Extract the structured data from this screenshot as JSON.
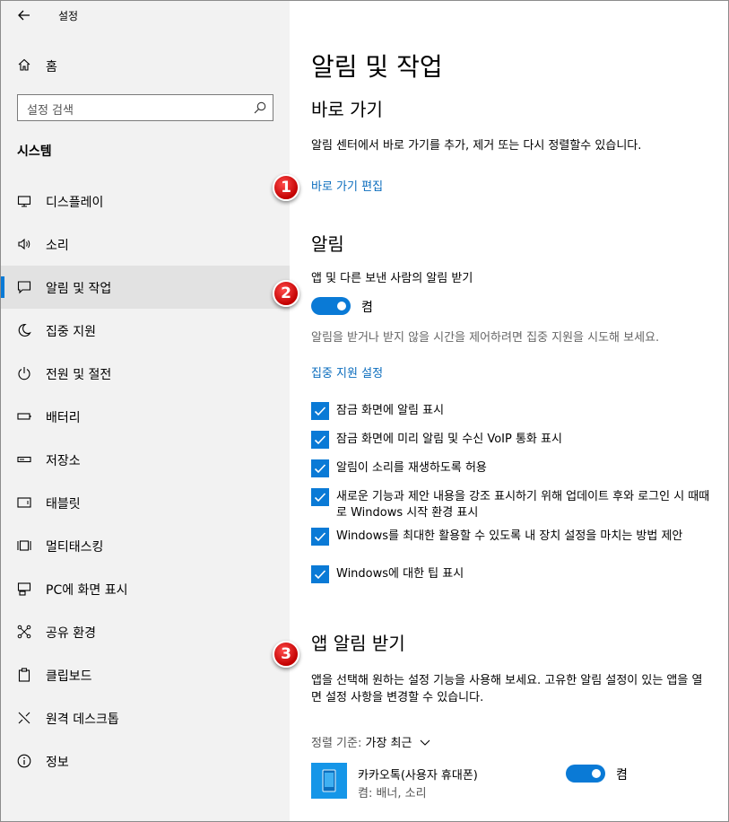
{
  "window": {
    "title": "설정"
  },
  "sidebar": {
    "home_label": "홈",
    "search_placeholder": "설정 검색",
    "section_title": "시스템",
    "items": [
      {
        "label": "디스플레이",
        "icon": "monitor-icon"
      },
      {
        "label": "소리",
        "icon": "speaker-icon"
      },
      {
        "label": "알림 및 작업",
        "icon": "notification-icon",
        "active": true
      },
      {
        "label": "집중 지원",
        "icon": "moon-icon"
      },
      {
        "label": "전원 및 절전",
        "icon": "power-icon"
      },
      {
        "label": "배터리",
        "icon": "battery-icon"
      },
      {
        "label": "저장소",
        "icon": "storage-icon"
      },
      {
        "label": "태블릿",
        "icon": "tablet-icon"
      },
      {
        "label": "멀티태스킹",
        "icon": "multitasking-icon"
      },
      {
        "label": "PC에 화면 표시",
        "icon": "project-icon"
      },
      {
        "label": "공유 환경",
        "icon": "share-icon"
      },
      {
        "label": "클립보드",
        "icon": "clipboard-icon"
      },
      {
        "label": "원격 데스크톱",
        "icon": "remote-desktop-icon"
      },
      {
        "label": "정보",
        "icon": "info-icon"
      }
    ]
  },
  "main": {
    "page_title": "알림 및 작업",
    "quick": {
      "heading": "바로 가기",
      "description": "알림 센터에서 바로 가기를 추가, 제거 또는 다시 정렬할수 있습니다.",
      "edit_link": "바로 가기 편집"
    },
    "notifications": {
      "heading": "알림",
      "toggle_title": "앱 및 다른 보낸 사람의 알림 받기",
      "toggle_state": "켬",
      "focus_desc": "알림을 받거나 받지 않을 시간을 제어하려면 집중 지원을 시도해 보세요.",
      "focus_link": "집중 지원 설정",
      "checkboxes": [
        "잠금 화면에 알림 표시",
        "잠금 화면에 미리 알림 및 수신 VoIP 통화 표시",
        "알림이 소리를 재생하도록 허용",
        "새로운 기능과 제안 내용을 강조 표시하기 위해 업데이트 후와 로그인 시 때때로 Windows 시작 환경 표시",
        "Windows를 최대한 활용할 수 있도록 내 장치 설정을 마치는 방법 제안",
        "Windows에 대한 팁 표시"
      ]
    },
    "app_notifications": {
      "heading": "앱 알림 받기",
      "description": "앱을 선택해 원하는 설정 기능을 사용해 보세요. 고유한 알림 설정이 있는 앱을 열면 설정 사항을 변경할 수 있습니다.",
      "sort_key": "정렬 기준:",
      "sort_value": "가장 최근",
      "apps": [
        {
          "name": "카카오톡(사용자 휴대폰)",
          "sub": "켬: 배너, 소리",
          "state": "켬"
        }
      ]
    }
  },
  "annotations": [
    "1",
    "2",
    "3"
  ],
  "colors": {
    "accent": "#0a7ad6",
    "link": "#0a6cbd",
    "badge": "#d40000",
    "sidebar_bg": "#f2f2f2"
  }
}
